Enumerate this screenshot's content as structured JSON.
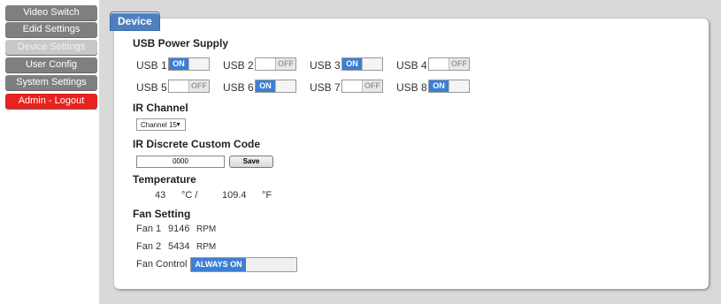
{
  "sidebar": {
    "items": [
      {
        "label": "Video Switch"
      },
      {
        "label": "Edid Settings"
      },
      {
        "label": "Device Settings"
      },
      {
        "label": "User Config"
      },
      {
        "label": "System Settings"
      },
      {
        "label": "Admin - Logout"
      }
    ]
  },
  "panel": {
    "tab_label": "Device",
    "usb": {
      "title": "USB Power Supply",
      "ports": [
        {
          "label": "USB 1",
          "state": "ON"
        },
        {
          "label": "USB 2",
          "state": "OFF"
        },
        {
          "label": "USB 3",
          "state": "ON"
        },
        {
          "label": "USB 4",
          "state": "OFF"
        },
        {
          "label": "USB 5",
          "state": "OFF"
        },
        {
          "label": "USB 6",
          "state": "ON"
        },
        {
          "label": "USB 7",
          "state": "OFF"
        },
        {
          "label": "USB 8",
          "state": "ON"
        }
      ]
    },
    "ir_channel": {
      "title": "IR Channel",
      "selected": "Channel 15"
    },
    "ir_code": {
      "title": "IR Discrete Custom Code",
      "value": "0000",
      "save_label": "Save"
    },
    "temperature": {
      "title": "Temperature",
      "celsius": "43",
      "celsius_unit": "°C  /",
      "fahrenheit": "109.4",
      "fahrenheit_unit": "°F"
    },
    "fan": {
      "title": "Fan Setting",
      "fan1_label": "Fan 1",
      "fan1_value": "9146",
      "fan2_label": "Fan 2",
      "fan2_value": "5434",
      "rpm_unit": "RPM",
      "control_label": "Fan Control",
      "control_value": "ALWAYS ON"
    }
  },
  "colors": {
    "accent": "#3c7fd4",
    "nav": "#7f7f7f",
    "logout": "#e8231e"
  }
}
